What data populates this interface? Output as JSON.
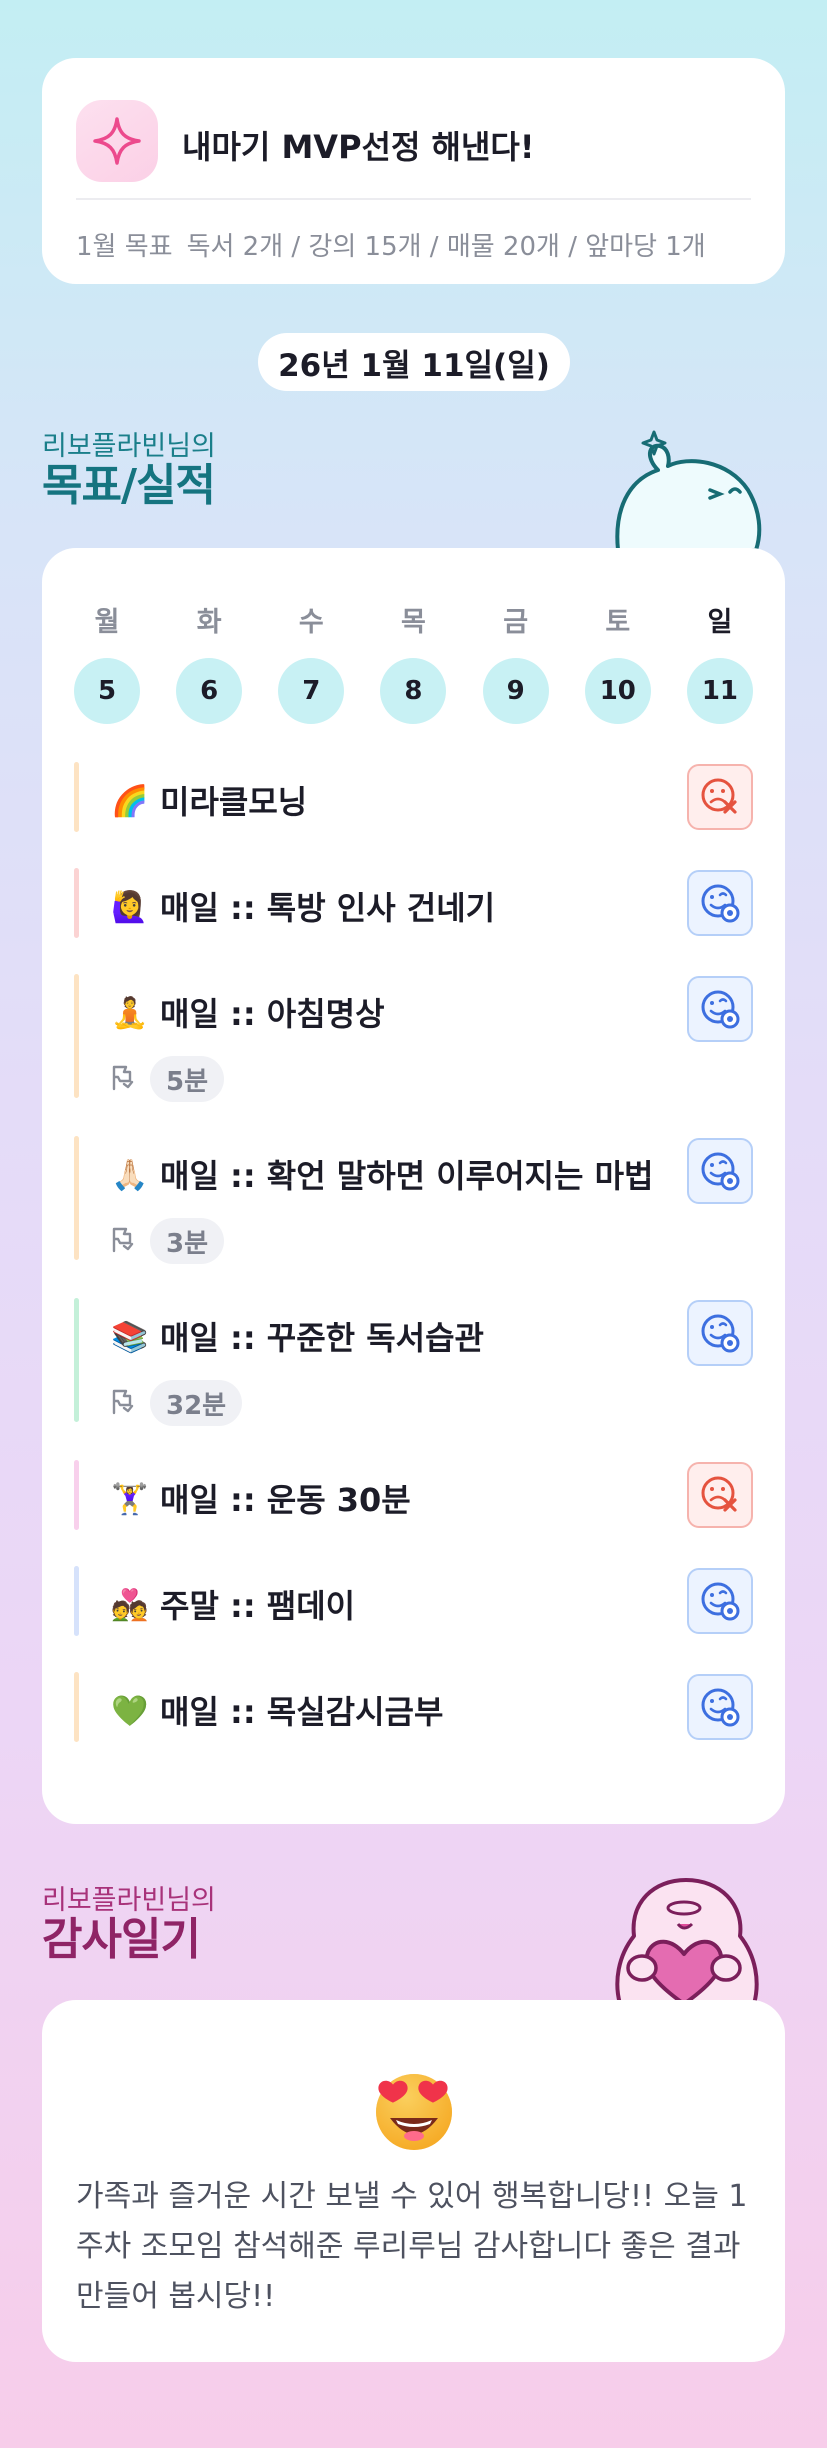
{
  "goal": {
    "title": "내마기 MVP선정 해낸다!",
    "month_label": "1월 목표",
    "month_goals": "독서 2개 / 강의 15개 / 매물 20개 / 앞마당 1개"
  },
  "date": "26년 1월 11일(일)",
  "goals_section": {
    "subtitle": "리보플라빈님의",
    "title": "목표/실적"
  },
  "week": {
    "days": [
      {
        "name": "월",
        "num": "5"
      },
      {
        "name": "화",
        "num": "6"
      },
      {
        "name": "수",
        "num": "7"
      },
      {
        "name": "목",
        "num": "8"
      },
      {
        "name": "금",
        "num": "9"
      },
      {
        "name": "토",
        "num": "10"
      },
      {
        "name": "일",
        "num": "11"
      }
    ],
    "active_day": "일"
  },
  "tasks": [
    {
      "emoji": "🌈",
      "title": "미라클모닝",
      "time": null,
      "status": "fail",
      "bar_color": "#fde3c3"
    },
    {
      "emoji": "🙋‍♀️",
      "title": "매일 :: 톡방 인사 건네기",
      "time": null,
      "status": "done",
      "bar_color": "#fbd3d3"
    },
    {
      "emoji": "🧘",
      "title": "매일 :: 아침명상",
      "time": "5분",
      "status": "done",
      "bar_color": "#fde3c3"
    },
    {
      "emoji": "🙏🏻",
      "title": "매일 :: 확언 말하면 이루어지는 마법",
      "time": "3분",
      "status": "done",
      "bar_color": "#fde3c3"
    },
    {
      "emoji": "📚",
      "title": "매일 :: 꾸준한 독서습관",
      "time": "32분",
      "status": "done",
      "bar_color": "#c4f0d9"
    },
    {
      "emoji": "🏋️‍♀️",
      "title": "매일 :: 운동 30분",
      "time": null,
      "status": "fail",
      "bar_color": "#f8d0ec"
    },
    {
      "emoji": "💑",
      "title": "주말 :: 팸데이",
      "time": null,
      "status": "done",
      "bar_color": "#d6e2fb"
    },
    {
      "emoji": "💚",
      "title": "매일 :: 목실감시금부",
      "time": null,
      "status": "done",
      "bar_color": "#fde3c3"
    }
  ],
  "gratitude_section": {
    "subtitle": "리보플라빈님의",
    "title": "감사일기"
  },
  "gratitude": {
    "emoji": "heart-eyes-face",
    "text": "가족과 즐거운 시간 보낼 수 있어 행복합니당!! 오늘 1주차 조모임 참석해준 루리루님 감사합니다 좋은 결과 만들어 봅시당!!"
  },
  "colors": {
    "accent_teal": "#157480",
    "accent_magenta": "#8f2466",
    "done_blue": "#3d6fe0",
    "fail_red": "#e5533f",
    "day_circle": "#c8f1f4"
  }
}
